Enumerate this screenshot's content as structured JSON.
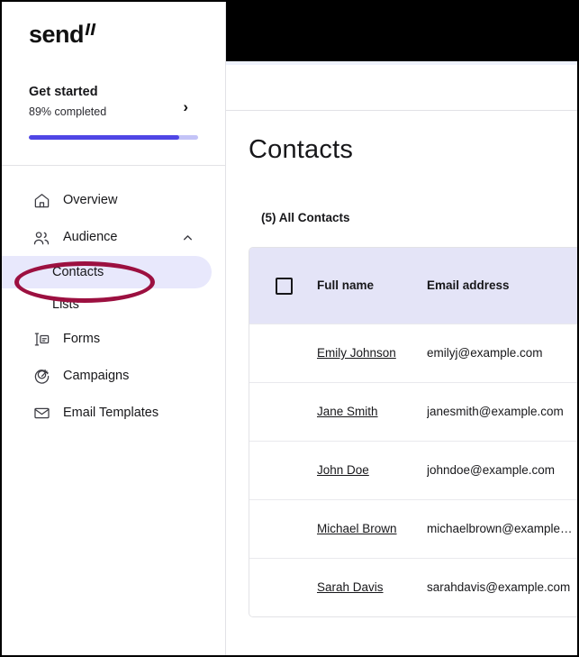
{
  "brand": {
    "logo_text": "send",
    "accent_color": "#4f46e5",
    "annotation_color": "#9c1040",
    "topbar_color": "#000000",
    "table_header_color": "#e4e4f7",
    "sidebar_active_color": "#e8e8fc"
  },
  "sidebar": {
    "get_started": {
      "title": "Get started",
      "subtitle": "89% completed",
      "percent": 89,
      "chevron": "›"
    },
    "items": [
      {
        "label": "Overview",
        "icon": "home-icon",
        "type": "nav"
      },
      {
        "label": "Audience",
        "icon": "people-icon",
        "type": "nav",
        "expanded": true,
        "chevron": "chevron-up-icon"
      },
      {
        "label": "Contacts",
        "type": "sub",
        "active": true
      },
      {
        "label": "Lists",
        "type": "sub",
        "active": false
      },
      {
        "label": "Forms",
        "icon": "forms-icon",
        "type": "nav"
      },
      {
        "label": "Campaigns",
        "icon": "target-icon",
        "type": "nav"
      },
      {
        "label": "Email Templates",
        "icon": "envelope-icon",
        "type": "nav"
      }
    ]
  },
  "main": {
    "page_title": "Contacts",
    "list_caption": "(5) All Contacts",
    "table": {
      "columns": [
        "Full name",
        "Email address"
      ],
      "rows": [
        {
          "name": "Emily Johnson",
          "email": "emilyj@example.com"
        },
        {
          "name": "Jane Smith",
          "email": "janesmith@example.com"
        },
        {
          "name": "John Doe",
          "email": "johndoe@example.com"
        },
        {
          "name": "Michael Brown",
          "email": "michaelbrown@example…"
        },
        {
          "name": "Sarah Davis",
          "email": "sarahdavis@example.com"
        }
      ]
    }
  }
}
